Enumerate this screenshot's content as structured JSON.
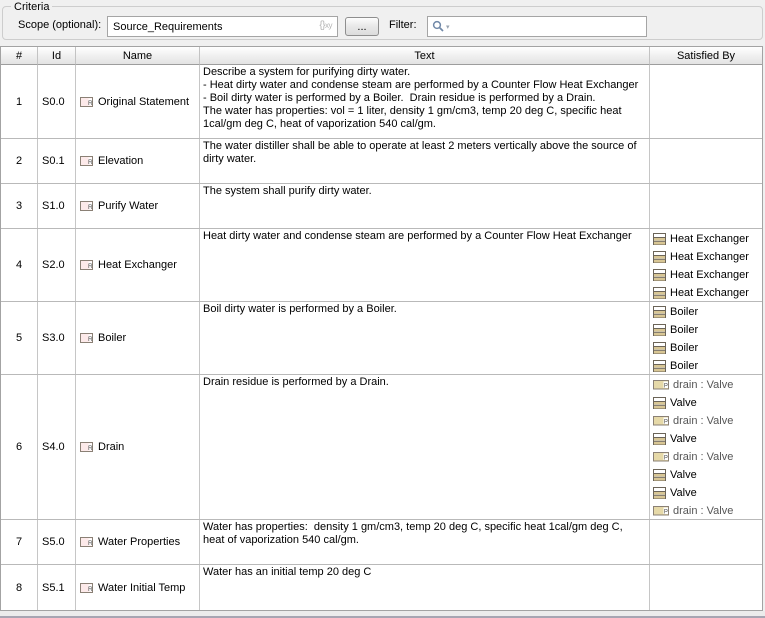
{
  "criteria": {
    "group_label": "Criteria",
    "scope_label": "Scope (optional):",
    "scope_value": "Source_Requirements",
    "expression_icon_text": "{}xy",
    "browse_button_label": "...",
    "filter_label": "Filter:"
  },
  "icon_colors": {
    "requirement_fill": "#fdeaea",
    "block_fill": "#d8c694",
    "part_fill": "#e6d9a8",
    "icon_border": "#6b6458"
  },
  "table": {
    "columns": [
      "#",
      "Id",
      "Name",
      "Text",
      "Satisfied By"
    ],
    "rows": [
      {
        "num": "1",
        "id": "S0.0",
        "name": "Original Statement",
        "name_icon": "requirement-icon",
        "text": "Describe a system for purifying dirty water.\n- Heat dirty water and condense steam are performed by a Counter Flow Heat Exchanger\n- Boil dirty water is performed by a Boiler.  Drain residue is performed by a Drain.\nThe water has properties: vol = 1 liter, density 1 gm/cm3, temp 20 deg C, specific heat\n1cal/gm deg C, heat of vaporization 540 cal/gm.",
        "satisfied": []
      },
      {
        "num": "2",
        "id": "S0.1",
        "name": "Elevation",
        "name_icon": "requirement-icon",
        "text": "The water distiller shall be able to operate at least 2 meters vertically above the source of\ndirty water.",
        "satisfied": []
      },
      {
        "num": "3",
        "id": "S1.0",
        "name": "Purify Water",
        "name_icon": "requirement-icon",
        "text": "The system shall purify dirty water.",
        "satisfied": []
      },
      {
        "num": "4",
        "id": "S2.0",
        "name": "Heat Exchanger",
        "name_icon": "requirement-icon",
        "text": "Heat dirty water and condense steam are performed by a Counter Flow Heat Exchanger",
        "satisfied": [
          {
            "icon": "block-icon",
            "label": "Heat Exchanger"
          },
          {
            "icon": "block-icon",
            "label": "Heat Exchanger"
          },
          {
            "icon": "block-icon",
            "label": "Heat Exchanger"
          },
          {
            "icon": "block-icon",
            "label": "Heat Exchanger"
          }
        ]
      },
      {
        "num": "5",
        "id": "S3.0",
        "name": "Boiler",
        "name_icon": "requirement-icon",
        "text": "Boil dirty water is performed by a Boiler.",
        "satisfied": [
          {
            "icon": "block-icon",
            "label": "Boiler"
          },
          {
            "icon": "block-icon",
            "label": "Boiler"
          },
          {
            "icon": "block-icon",
            "label": "Boiler"
          },
          {
            "icon": "block-icon",
            "label": "Boiler"
          }
        ]
      },
      {
        "num": "6",
        "id": "S4.0",
        "name": "Drain",
        "name_icon": "requirement-icon",
        "text": "Drain residue is performed by a Drain.",
        "satisfied": [
          {
            "icon": "part-property-icon",
            "label": "drain : Valve"
          },
          {
            "icon": "block-icon",
            "label": "Valve"
          },
          {
            "icon": "part-property-icon",
            "label": "drain : Valve"
          },
          {
            "icon": "block-icon",
            "label": "Valve"
          },
          {
            "icon": "part-property-icon",
            "label": "drain : Valve"
          },
          {
            "icon": "block-icon",
            "label": "Valve"
          },
          {
            "icon": "block-icon",
            "label": "Valve"
          },
          {
            "icon": "part-property-icon",
            "label": "drain : Valve"
          }
        ]
      },
      {
        "num": "7",
        "id": "S5.0",
        "name": "Water Properties",
        "name_icon": "requirement-icon",
        "text": "Water has properties:  density 1 gm/cm3, temp 20 deg C, specific heat 1cal/gm deg C,\nheat of vaporization 540 cal/gm.",
        "satisfied": []
      },
      {
        "num": "8",
        "id": "S5.1",
        "name": "Water Initial Temp",
        "name_icon": "requirement-icon",
        "text": "Water has an initial temp 20 deg C",
        "satisfied": []
      }
    ]
  }
}
